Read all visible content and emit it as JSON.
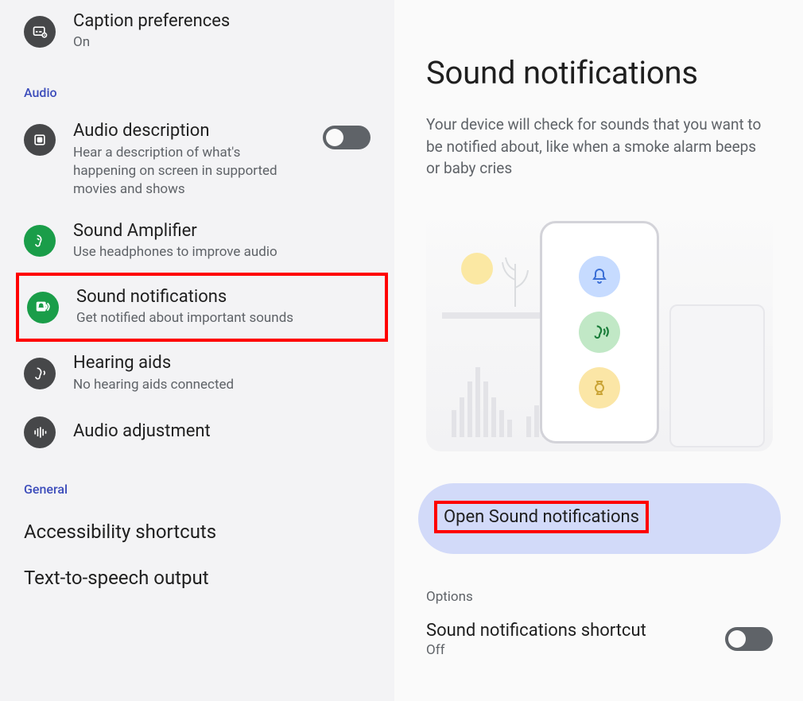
{
  "left": {
    "caption_prefs": {
      "title": "Caption preferences",
      "sub": "On"
    },
    "section_audio": "Audio",
    "audio_desc": {
      "title": "Audio description",
      "sub": "Hear a description of what's happening on screen in supported movies and shows"
    },
    "sound_amp": {
      "title": "Sound Amplifier",
      "sub": "Use headphones to improve audio"
    },
    "sound_notif": {
      "title": "Sound notifications",
      "sub": "Get notified about important sounds"
    },
    "hearing_aids": {
      "title": "Hearing aids",
      "sub": "No hearing aids connected"
    },
    "audio_adjust": {
      "title": "Audio adjustment"
    },
    "section_general": "General",
    "a11y_shortcuts": "Accessibility shortcuts",
    "tts_output": "Text-to-speech output"
  },
  "right": {
    "title": "Sound notifications",
    "desc": "Your device will check for sounds that you want to be notified about, like when a smoke alarm beeps or baby cries",
    "open_button": "Open Sound notifications",
    "options_header": "Options",
    "shortcut": {
      "title": "Sound notifications shortcut",
      "sub": "Off"
    }
  }
}
